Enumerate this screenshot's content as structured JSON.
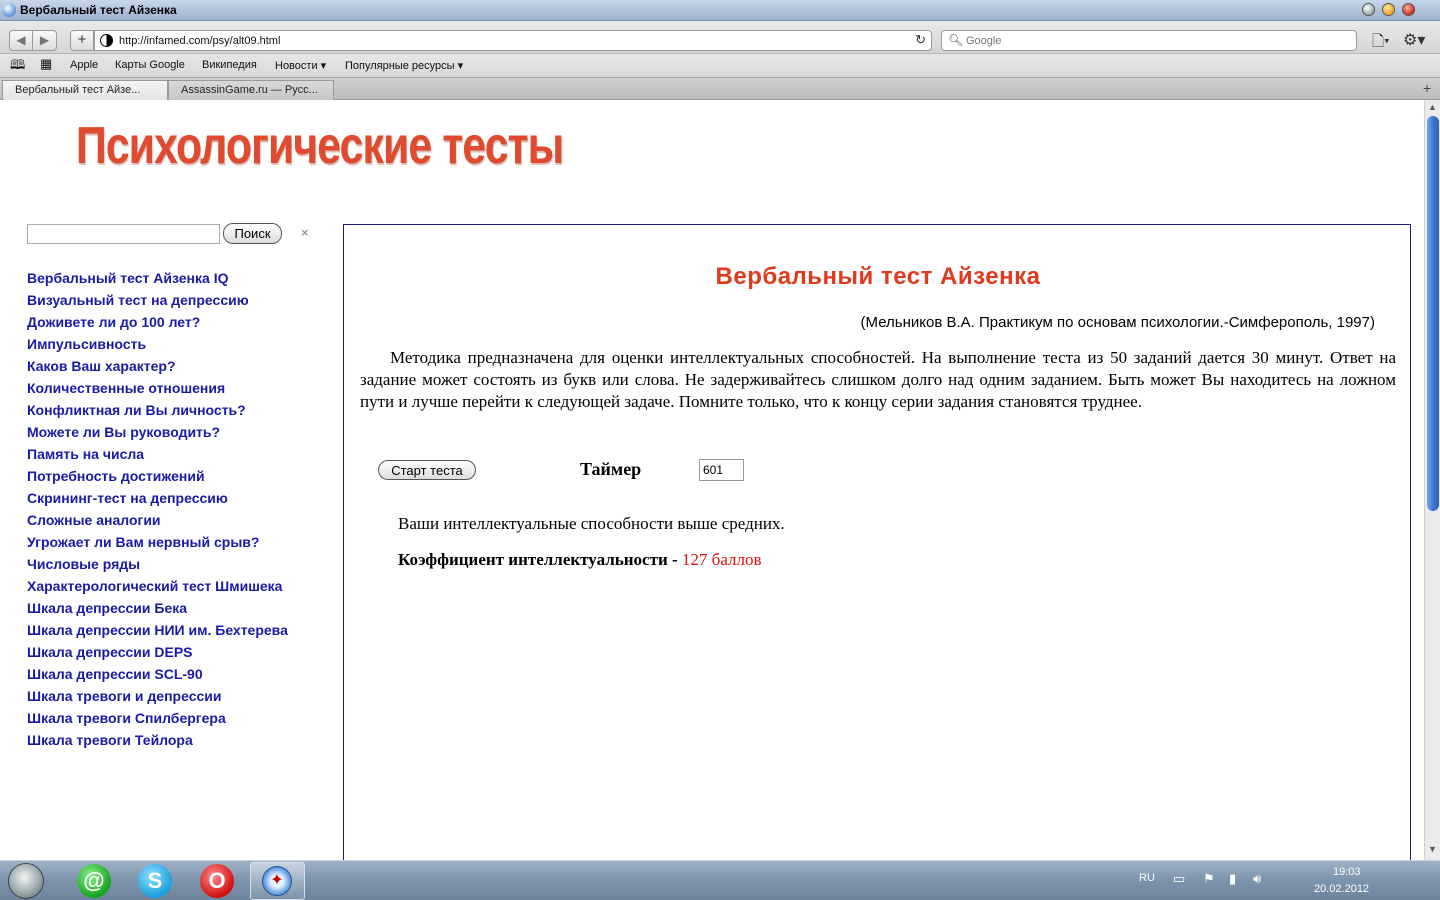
{
  "window": {
    "title": "Вербальный тест Айзенка"
  },
  "toolbar": {
    "url": "http://infamed.com/psy/alt09.html",
    "search_placeholder": "Google"
  },
  "bookmarks": [
    "Apple",
    "Карты Google",
    "Википедия",
    "Новости ▾",
    "Популярные ресурсы ▾"
  ],
  "tabs": [
    {
      "label": "Вербальный тест Айзе..."
    },
    {
      "label": "AssassinGame.ru — Русс..."
    }
  ],
  "page": {
    "logo": "Психологические тесты",
    "search_button": "Поиск",
    "search_clear": "×",
    "nav": [
      "Вербальный тест Айзенка IQ",
      "Визуальный тест на депрессию",
      "Доживете ли до 100 лет?",
      "Импульсивность",
      "Каков Ваш характер?",
      "Количественные отношения",
      "Конфликтная ли Вы личность?",
      "Можете ли Вы руководить?",
      "Память на числа",
      "Потребность достижений",
      "Скрининг-тест на депрессию",
      "Сложные аналогии",
      "Угрожает ли Вам нервный срыв?",
      "Числовые ряды",
      "Характерологический тест Шмишека",
      "Шкала депрессии Бека",
      "Шкала депрессии НИИ им. Бехтерева",
      "Шкала депрессии DEPS",
      "Шкала депрессии SCL-90",
      "Шкала тревоги и депрессии",
      "Шкала тревоги Спилбергера",
      "Шкала тревоги Тейлора"
    ],
    "test_title": "Вербальный тест Айзенка",
    "citation": "(Мельников В.А. Практикум по основам психологии.-Симферополь, 1997)",
    "description": "Методика предназначена для оценки интеллектуальных способностей. На выполнение теста из 50 заданий дается 30 минут. Ответ на задание может состоять из букв или слова. Не задерживайтесь слишком долго над одним заданием. Быть может Вы находитесь на ложном пути и лучше перейти к следующей задаче. Помните только, что к концу серии задания становятся труднее.",
    "start_button": "Старт теста",
    "timer_label": "Таймер",
    "timer_value": "601",
    "result_text": "Ваши интеллектуальные способности выше средних.",
    "iq_label": "Коэффициент интеллектуальности - ",
    "iq_value": "127 баллов"
  },
  "taskbar": {
    "language": "RU",
    "time": "19:03",
    "date": "20.02.2012"
  },
  "colors": {
    "title_red": "#e03a1e",
    "link_blue": "#1a1aa6",
    "iq_red": "#e01010",
    "content_border": "#1b1b8a"
  }
}
